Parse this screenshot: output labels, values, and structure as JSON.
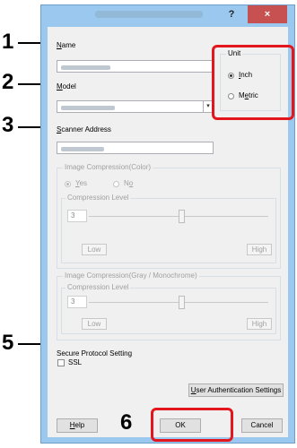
{
  "callouts": [
    "1",
    "2",
    "3",
    "5",
    "6"
  ],
  "window": {
    "help_symbol": "?",
    "close_symbol": "×"
  },
  "name": {
    "label": "Name"
  },
  "model": {
    "label": "Model"
  },
  "scanner_address": {
    "label": "Scanner Address"
  },
  "unit": {
    "label": "Unit",
    "options": [
      "Inch",
      "Metric"
    ],
    "selected": "Inch"
  },
  "color_compression": {
    "label": "Image Compression(Color)",
    "options": [
      "Yes",
      "No"
    ],
    "selected": "Yes",
    "level_label": "Compression Level",
    "level_value": "3",
    "low_label": "Low",
    "high_label": "High"
  },
  "gray_compression": {
    "label": "Image Compression(Gray / Monochrome)",
    "level_label": "Compression Level",
    "level_value": "3",
    "low_label": "Low",
    "high_label": "High"
  },
  "secure_protocol": {
    "label": "Secure Protocol Setting",
    "ssl_label": "SSL",
    "ssl_checked": false
  },
  "buttons": {
    "user_auth": "User Authentication Settings",
    "help": "Help",
    "ok": "OK",
    "cancel": "Cancel"
  },
  "colors": {
    "highlight": "#e2161c",
    "window_frame": "#9bc8ee",
    "close_button": "#c75050"
  }
}
